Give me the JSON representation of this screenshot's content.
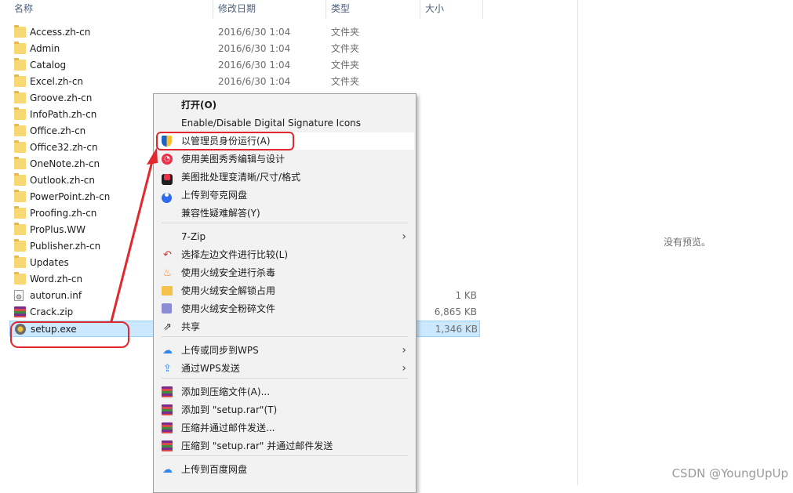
{
  "header": {
    "col_name": "名称",
    "col_date": "修改日期",
    "col_type": "类型",
    "col_size": "大小"
  },
  "files": [
    {
      "name": "Access.zh-cn",
      "date": "2016/6/30 1:04",
      "type": "文件夹",
      "size": "",
      "icon": "folder-icon"
    },
    {
      "name": "Admin",
      "date": "2016/6/30 1:04",
      "type": "文件夹",
      "size": "",
      "icon": "folder-icon"
    },
    {
      "name": "Catalog",
      "date": "2016/6/30 1:04",
      "type": "文件夹",
      "size": "",
      "icon": "folder-icon"
    },
    {
      "name": "Excel.zh-cn",
      "date": "2016/6/30 1:04",
      "type": "文件夹",
      "size": "",
      "icon": "folder-icon"
    },
    {
      "name": "Groove.zh-cn",
      "date": "",
      "type": "",
      "size": "",
      "icon": "folder-icon"
    },
    {
      "name": "InfoPath.zh-cn",
      "date": "",
      "type": "",
      "size": "",
      "icon": "folder-icon"
    },
    {
      "name": "Office.zh-cn",
      "date": "",
      "type": "",
      "size": "",
      "icon": "folder-icon"
    },
    {
      "name": "Office32.zh-cn",
      "date": "",
      "type": "",
      "size": "",
      "icon": "folder-icon"
    },
    {
      "name": "OneNote.zh-cn",
      "date": "",
      "type": "",
      "size": "",
      "icon": "folder-icon"
    },
    {
      "name": "Outlook.zh-cn",
      "date": "",
      "type": "",
      "size": "",
      "icon": "folder-icon"
    },
    {
      "name": "PowerPoint.zh-cn",
      "date": "",
      "type": "",
      "size": "",
      "icon": "folder-icon"
    },
    {
      "name": "Proofing.zh-cn",
      "date": "",
      "type": "",
      "size": "",
      "icon": "folder-icon"
    },
    {
      "name": "ProPlus.WW",
      "date": "",
      "type": "",
      "size": "",
      "icon": "folder-icon"
    },
    {
      "name": "Publisher.zh-cn",
      "date": "",
      "type": "",
      "size": "",
      "icon": "folder-icon"
    },
    {
      "name": "Updates",
      "date": "",
      "type": "",
      "size": "",
      "icon": "folder-icon"
    },
    {
      "name": "Word.zh-cn",
      "date": "",
      "type": "",
      "size": "",
      "icon": "folder-icon"
    },
    {
      "name": "autorun.inf",
      "date": "",
      "type": "",
      "size": "1 KB",
      "icon": "settings-file-icon"
    },
    {
      "name": "Crack.zip",
      "date": "",
      "type": "",
      "size": "6,865 KB",
      "icon": "winrar-icon"
    },
    {
      "name": "setup.exe",
      "date": "",
      "type": "",
      "size": "1,346 KB",
      "icon": "setup-exe-icon",
      "selected": true
    }
  ],
  "preview": {
    "text": "没有预览。"
  },
  "menu": {
    "items": [
      {
        "label": "打开(O)",
        "icon": "",
        "bold": true
      },
      {
        "label": "Enable/Disable Digital Signature Icons",
        "icon": ""
      },
      {
        "label": "以管理员身份运行(A)",
        "icon": "uac-shield-icon",
        "highlight": true
      },
      {
        "label": "使用美图秀秀编辑与设计",
        "icon": "meitu-icon"
      },
      {
        "label": "美图批处理变清晰/尺寸/格式",
        "icon": "meitu-batch-icon"
      },
      {
        "label": "上传到夸克网盘",
        "icon": "quark-icon"
      },
      {
        "label": "兼容性疑难解答(Y)",
        "icon": ""
      },
      {
        "label": "7-Zip",
        "icon": "",
        "submenu": true
      },
      {
        "label": "选择左边文件进行比较(L)",
        "icon": "compare-icon"
      },
      {
        "label": "使用火绒安全进行杀毒",
        "icon": "huorong-icon"
      },
      {
        "label": "使用火绒安全解锁占用",
        "icon": "unlock-folder-icon"
      },
      {
        "label": "使用火绒安全粉碎文件",
        "icon": "shredder-icon"
      },
      {
        "label": "共享",
        "icon": "share-icon"
      },
      {
        "label": "上传或同步到WPS",
        "icon": "wps-cloud-icon",
        "submenu": true
      },
      {
        "label": "通过WPS发送",
        "icon": "wps-send-icon",
        "submenu": true
      },
      {
        "label": "添加到压缩文件(A)...",
        "icon": "winrar-icon"
      },
      {
        "label": "添加到 \"setup.rar\"(T)",
        "icon": "winrar-icon"
      },
      {
        "label": "压缩并通过邮件发送...",
        "icon": "winrar-icon"
      },
      {
        "label": "压缩到 \"setup.rar\" 并通过邮件发送",
        "icon": "winrar-icon"
      },
      {
        "label": "上传到百度网盘",
        "icon": "baidu-icon"
      }
    ]
  },
  "watermark": {
    "text": "CSDN @YoungUpUp"
  },
  "colors": {
    "annotation": "#e0282d",
    "selection": "#cce8ff",
    "menu_bg": "#f2f2f2"
  }
}
